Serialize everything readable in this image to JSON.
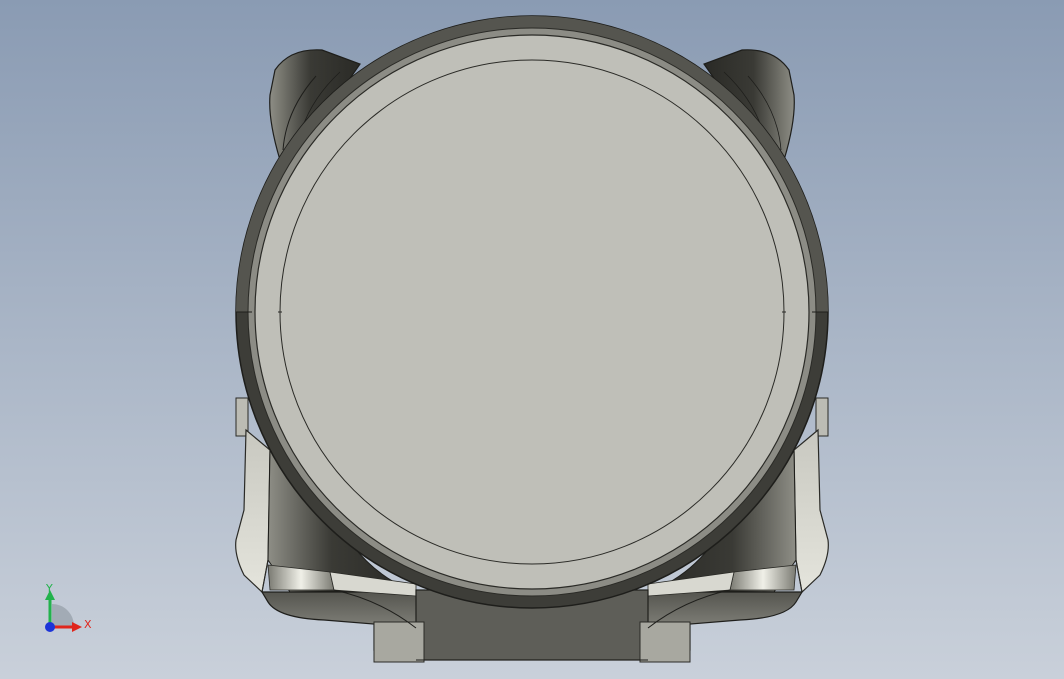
{
  "viewport": {
    "background_top": "#8a9bb3",
    "background_bottom": "#c9d0da"
  },
  "part": {
    "face_color": "#bfbfb8",
    "body_dark": "#3f3f3a",
    "body_mid": "#6b6b64",
    "body_light": "#e0e0d8"
  },
  "triad": {
    "x_label": "X",
    "y_label": "Y",
    "x_color": "#e0261c",
    "y_color": "#22b24c",
    "z_color": "#1c34d8"
  }
}
